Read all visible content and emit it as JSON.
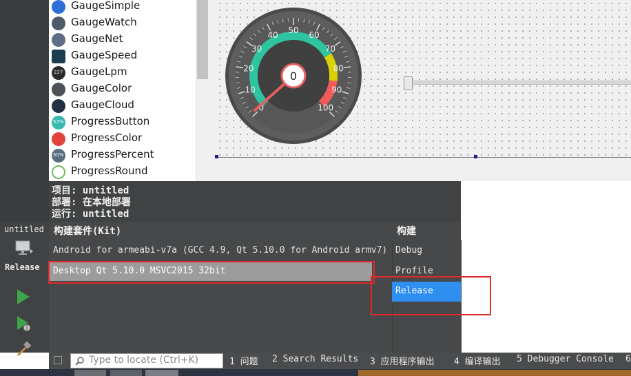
{
  "widget_list": {
    "items": [
      {
        "label": "GaugeSimple",
        "icon": "gauge-simple-icon",
        "color": "#2d6fd6"
      },
      {
        "label": "GaugeWatch",
        "icon": "gauge-watch-icon",
        "color": "#50596a"
      },
      {
        "label": "GaugeNet",
        "icon": "gauge-net-icon",
        "color": "#5c6f86"
      },
      {
        "label": "GaugeSpeed",
        "icon": "gauge-speed-icon",
        "color": "#1d3e4f"
      },
      {
        "label": "GaugeLpm",
        "icon": "gauge-lpm-icon",
        "color": "#2b2b2b"
      },
      {
        "label": "GaugeColor",
        "icon": "gauge-color-icon",
        "color": "#4d5258"
      },
      {
        "label": "GaugeCloud",
        "icon": "gauge-cloud-icon",
        "color": "#223040"
      },
      {
        "label": "ProgressButton",
        "icon": "progress-button-icon",
        "color": "#38b7b0"
      },
      {
        "label": "ProgressColor",
        "icon": "progress-color-icon",
        "color": "#e0453d"
      },
      {
        "label": "ProgressPercent",
        "icon": "progress-percent-icon",
        "color": "#596e7c"
      },
      {
        "label": "ProgressRound",
        "icon": "progress-round-icon",
        "color": "#6dbb5f"
      }
    ],
    "progress_button_text": "57%",
    "progress_percent_text": "50%",
    "gauge_lpm_text": "227"
  },
  "gauge": {
    "value": "0",
    "tick_labels": [
      "0",
      "10",
      "20",
      "30",
      "40",
      "50",
      "60",
      "70",
      "80",
      "90",
      "100"
    ],
    "colors": {
      "green": "#2ec4a0",
      "yellow": "#d8d000",
      "red": "#f25a5a"
    }
  },
  "kit_popup": {
    "project_line": "项目: untitled",
    "deploy_line": "部署: 在本地部署",
    "run_line": "运行: untitled",
    "kit_header": "构建套件(Kit)",
    "build_header": "构建",
    "kits": [
      "Android for armeabi-v7a (GCC 4.9, Qt 5.10.0 for Android armv7)",
      "Desktop Qt 5.10.0 MSVC2015 32bit"
    ],
    "build_configs": [
      "Debug",
      "Profile",
      "Release"
    ],
    "selected_kit_index": 1,
    "selected_build_index": 2,
    "selection_color": "#2e8ff0",
    "annotation_color": "#e02a2a"
  },
  "mode_bar": {
    "project_name": "untitled",
    "build_mode": "Release"
  },
  "statusbar": {
    "locator_placeholder": "Type to locate (Ctrl+K)",
    "tabs": [
      "1 问题",
      "2 Search Results",
      "3 应用程序输出",
      "4 编译输出",
      "5 Debugger Console",
      "6"
    ]
  }
}
